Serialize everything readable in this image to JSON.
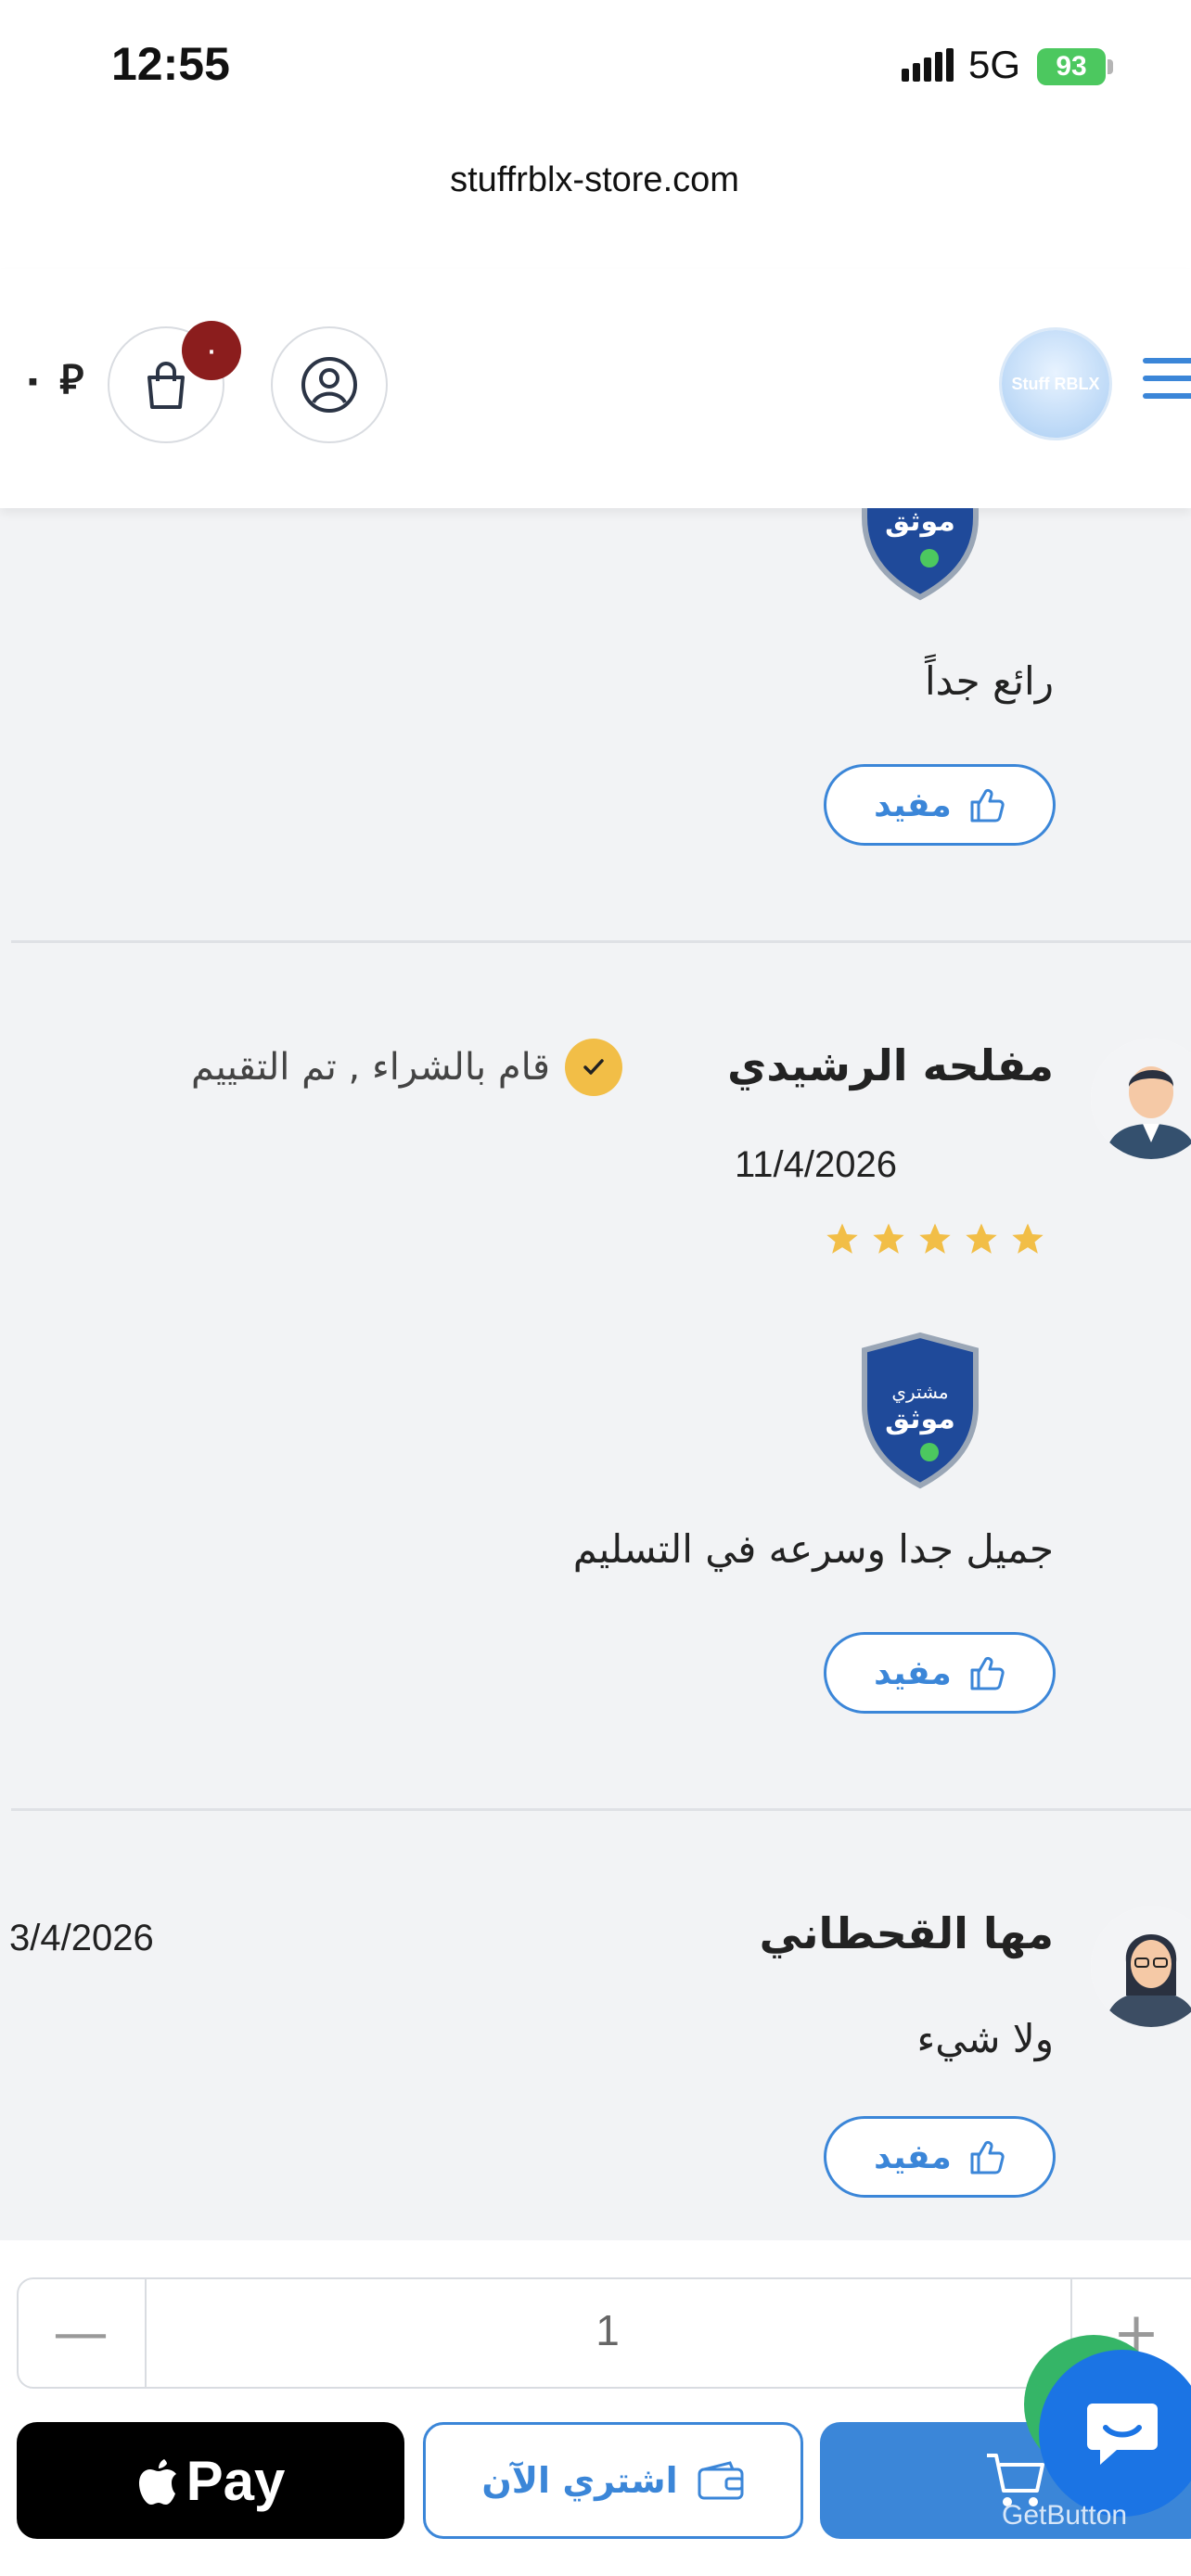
{
  "status": {
    "time": "12:55",
    "network": "5G",
    "battery": "93"
  },
  "browser": {
    "url": "stuffrblx-store.com"
  },
  "header": {
    "cart_total": "٠ ⃁",
    "cart_count": "٠",
    "logo_text": "Stuff RBLX"
  },
  "reviews": [
    {
      "comment": "رائع جداً",
      "helpful_label": "مفيد"
    },
    {
      "name": "مفلحه الرشيدي",
      "verified_label": "قام بالشراء , تم التقييم",
      "date": "11/4/2026",
      "rating": 5,
      "comment": "جميل جدا وسرعه في التسليم",
      "helpful_label": "مفيد"
    },
    {
      "name": "مها القحطاني",
      "date": "3/4/2026",
      "comment": "ولا شيء",
      "helpful_label": "مفيد"
    }
  ],
  "purchase": {
    "quantity": "1",
    "minus": "—",
    "plus": "+",
    "apple_pay_label": "Pay",
    "buy_now_label": "اشتري الآن",
    "getbutton_label": "GetButton"
  },
  "colors": {
    "accent": "#3b86d8",
    "badge": "#8b1d1d",
    "star": "#f2be47",
    "chat": "#1b74e4"
  }
}
